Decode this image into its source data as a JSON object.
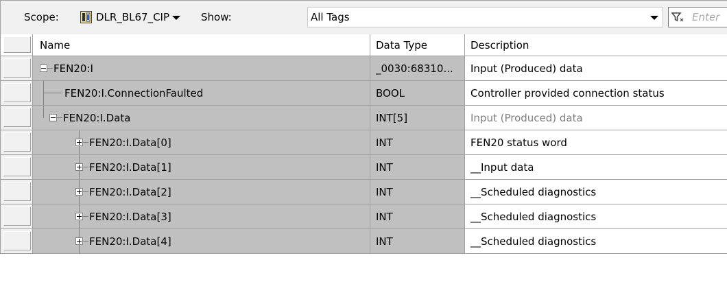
{
  "toolbar": {
    "scope_label": "Scope:",
    "scope_value": "DLR_BL67_CIP",
    "show_label": "Show:",
    "show_value": "All Tags",
    "filter_placeholder": "Enter"
  },
  "columns": {
    "name": "Name",
    "data_type": "Data Type",
    "description": "Description"
  },
  "rows": [
    {
      "name": "FEN20:I",
      "data_type": "_0030:68310...",
      "description": "Input (Produced) data",
      "desc_muted": false,
      "level": 0,
      "expander": "minus"
    },
    {
      "name": "FEN20:I.ConnectionFaulted",
      "data_type": "BOOL",
      "description": "Controller provided connection status",
      "desc_muted": false,
      "level": 1,
      "expander": "none"
    },
    {
      "name": "FEN20:I.Data",
      "data_type": "INT[5]",
      "description": "Input (Produced) data",
      "desc_muted": true,
      "level": 1,
      "expander": "minus"
    },
    {
      "name": "FEN20:I.Data[0]",
      "data_type": "INT",
      "description": "FEN20 status word",
      "desc_muted": false,
      "level": 2,
      "expander": "plus"
    },
    {
      "name": "FEN20:I.Data[1]",
      "data_type": "INT",
      "description": "__Input data",
      "desc_muted": false,
      "level": 2,
      "expander": "plus"
    },
    {
      "name": "FEN20:I.Data[2]",
      "data_type": "INT",
      "description": "__Scheduled diagnostics",
      "desc_muted": false,
      "level": 2,
      "expander": "plus"
    },
    {
      "name": "FEN20:I.Data[3]",
      "data_type": "INT",
      "description": "__Scheduled diagnostics",
      "desc_muted": false,
      "level": 2,
      "expander": "plus"
    },
    {
      "name": "FEN20:I.Data[4]",
      "data_type": "INT",
      "description": "__Scheduled diagnostics",
      "desc_muted": false,
      "level": 2,
      "expander": "plus"
    }
  ],
  "colors": {
    "grid_line": "#a0a0a0",
    "readonly_cell": "#c0c0c0",
    "muted_text": "#7f7f7f"
  },
  "icons": {
    "scope": "controller-icon",
    "dropdown": "caret-down-icon",
    "filter": "filter-icon",
    "expand": "plus-box-icon",
    "collapse": "minus-box-icon"
  }
}
